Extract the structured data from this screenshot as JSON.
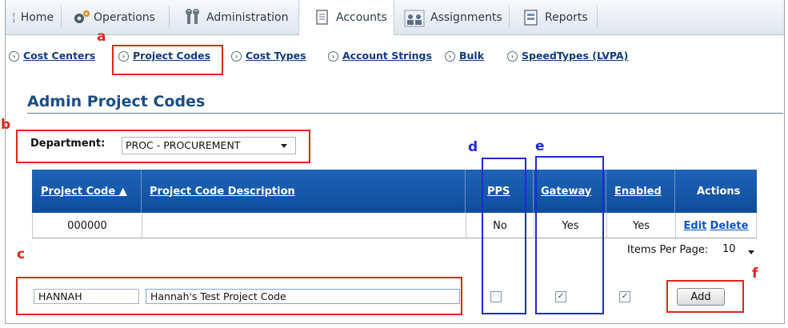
{
  "nav": {
    "tabs": [
      {
        "label": "Home",
        "icon": "separator-icon"
      },
      {
        "label": "Operations",
        "icon": "gears-icon"
      },
      {
        "label": "Administration",
        "icon": "tools-icon"
      },
      {
        "label": "Accounts",
        "icon": "document-icon"
      },
      {
        "label": "Assignments",
        "icon": "people-icon"
      },
      {
        "label": "Reports",
        "icon": "report-icon"
      }
    ],
    "active_tab": "Accounts"
  },
  "subnav": [
    "Cost Centers",
    "Project Codes",
    "Cost Types",
    "Account Strings",
    "Bulk",
    "SpeedTypes (LVPA)"
  ],
  "page": {
    "title": "Admin Project Codes",
    "department_label": "Department:",
    "department_value": "PROC - PROCUREMENT"
  },
  "grid": {
    "headers": [
      "Project Code ▲",
      "Project Code Description",
      "PPS",
      "Gateway",
      "Enabled",
      "Actions"
    ],
    "rows": [
      {
        "code": "000000",
        "description": "",
        "pps": "No",
        "gateway": "Yes",
        "enabled": "Yes",
        "edit": "Edit",
        "delete": "Delete"
      }
    ]
  },
  "paging": {
    "label": "Items Per Page:",
    "value": "10"
  },
  "new_row": {
    "code": "HANNAH",
    "description": "Hannah's Test Project Code",
    "pps_checked": false,
    "gateway_checked": true,
    "enabled_checked": true,
    "add_label": "Add"
  },
  "annotations": {
    "a": "a",
    "b": "b",
    "c": "c",
    "d": "d",
    "e": "e",
    "f": "f"
  },
  "colors": {
    "header_blue": "#0d4d9b",
    "title_blue": "#1a4d86",
    "annotation_red": "#e2231a",
    "annotation_blue": "#1f2ad6"
  }
}
